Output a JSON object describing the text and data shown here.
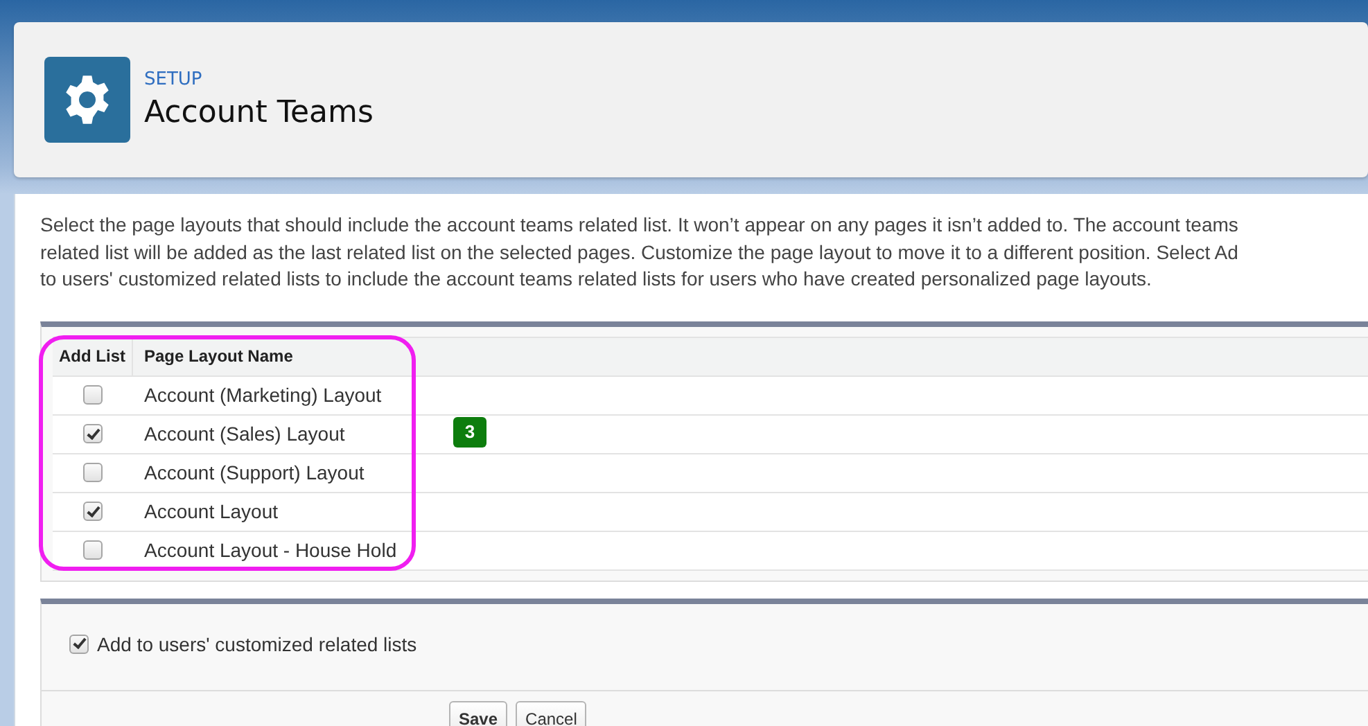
{
  "header": {
    "eyebrow": "SETUP",
    "title": "Account Teams"
  },
  "description_lines": [
    "Select the page layouts that should include the account teams related list. It won’t appear on any pages it isn’t added to. The account teams",
    "related list will be added as the last related list on the selected pages. Customize the page layout to move it to a different position. Select Ad",
    "to users' customized related lists to include the account teams related lists for users who have created personalized page layouts."
  ],
  "table": {
    "columns": [
      "Add List",
      "Page Layout Name"
    ],
    "rows": [
      {
        "checked": false,
        "name": "Account (Marketing) Layout"
      },
      {
        "checked": true,
        "name": "Account (Sales) Layout"
      },
      {
        "checked": false,
        "name": "Account (Support) Layout"
      },
      {
        "checked": true,
        "name": "Account Layout"
      },
      {
        "checked": false,
        "name": "Account Layout - House Hold"
      }
    ]
  },
  "badge": {
    "text": "3"
  },
  "option": {
    "label": "Add to users' customized related lists",
    "checked": true
  },
  "buttons": [
    "Save",
    "Cancel"
  ]
}
